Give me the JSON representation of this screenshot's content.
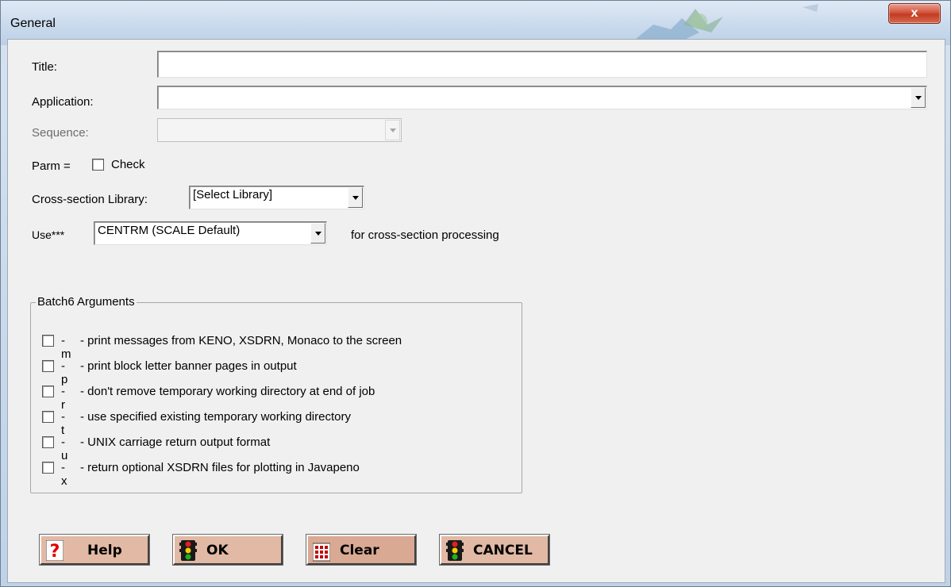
{
  "window": {
    "title": "General",
    "close_label": "x"
  },
  "form": {
    "title_label": "Title:",
    "title_value": "",
    "application_label": "Application:",
    "application_value": "",
    "sequence_label": "Sequence:",
    "sequence_value": "",
    "parm_label": "Parm =",
    "parm_check_label": "Check",
    "parm_checked": false,
    "xs_library_label": "Cross-section Library:",
    "xs_library_value": "[Select Library]",
    "use_label": "Use***",
    "use_value": "CENTRM (SCALE Default)",
    "use_suffix": "for cross-section processing"
  },
  "batch": {
    "group_title": "Batch6 Arguments",
    "options": [
      {
        "flag": "-m",
        "desc": "- print messages from KENO, XSDRN, Monaco to the screen",
        "checked": false
      },
      {
        "flag": "-p",
        "desc": "- print block letter banner pages in output",
        "checked": false
      },
      {
        "flag": "-r",
        "desc": "- don't remove temporary working directory at end of job",
        "checked": false
      },
      {
        "flag": "-t",
        "desc": "- use specified existing temporary working directory",
        "checked": false
      },
      {
        "flag": "-u",
        "desc": "- UNIX carriage return output format",
        "checked": false
      },
      {
        "flag": "-x",
        "desc": "- return optional XSDRN files for plotting in Javapeno",
        "checked": false
      }
    ]
  },
  "buttons": {
    "help": {
      "label": "Help",
      "icon": "question-mark-icon"
    },
    "ok": {
      "label": "OK",
      "icon": "traffic-light-icon"
    },
    "clear": {
      "label": "Clear",
      "icon": "grid-icon"
    },
    "cancel": {
      "label": "CANCEL",
      "icon": "traffic-light-icon"
    }
  },
  "colors": {
    "button_bg": "#e2b9a4",
    "close_button": "#c23b22",
    "dialog_bg": "#f0f0f0"
  }
}
